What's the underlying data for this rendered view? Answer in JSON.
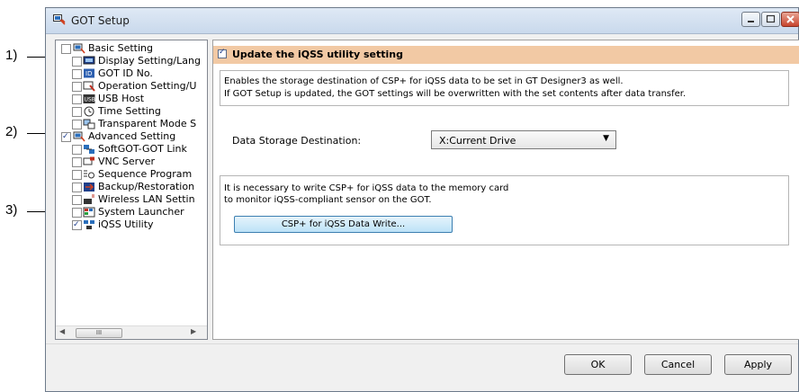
{
  "callouts": [
    "1)",
    "2)",
    "3)"
  ],
  "window": {
    "title": "GOT Setup",
    "controls": [
      "minimize-icon",
      "maximize-icon",
      "close-icon"
    ]
  },
  "tree": {
    "items": [
      {
        "label": "Basic Setting",
        "checked": false,
        "icon": "settings-folder-icon"
      },
      {
        "label": "Display Setting/Lang",
        "checked": false,
        "icon": "display-icon"
      },
      {
        "label": "GOT ID No.",
        "checked": false,
        "icon": "id-icon"
      },
      {
        "label": "Operation Setting/U",
        "checked": false,
        "icon": "operation-icon"
      },
      {
        "label": "USB Host",
        "checked": false,
        "icon": "usb-icon"
      },
      {
        "label": "Time Setting",
        "checked": false,
        "icon": "clock-icon"
      },
      {
        "label": "Transparent Mode S",
        "checked": false,
        "icon": "transparent-mode-icon"
      },
      {
        "label": "Advanced Setting",
        "checked": true,
        "icon": "settings-folder-icon"
      },
      {
        "label": "SoftGOT-GOT Link",
        "checked": false,
        "icon": "link-icon"
      },
      {
        "label": "VNC Server",
        "checked": false,
        "icon": "vnc-icon"
      },
      {
        "label": "Sequence Program",
        "checked": false,
        "icon": "sequence-icon"
      },
      {
        "label": "Backup/Restoration",
        "checked": false,
        "icon": "backup-icon"
      },
      {
        "label": "Wireless LAN Settin",
        "checked": false,
        "icon": "wireless-icon"
      },
      {
        "label": "System Launcher",
        "checked": false,
        "icon": "launcher-icon"
      },
      {
        "label": "iQSS Utility",
        "checked": true,
        "icon": "iqss-icon"
      }
    ],
    "scroll_thumb": "III"
  },
  "main": {
    "header_checkbox_checked": true,
    "header_label": "Update the iQSS utility setting",
    "description": [
      "Enables the storage destination of CSP+ for iQSS data to be set in GT Designer3 as well.",
      "If GOT Setup is updated, the GOT settings will be overwritten with the set contents after data transfer."
    ],
    "storage_label": "Data Storage Destination:",
    "storage_value": "X:Current Drive",
    "write_info": [
      "It is necessary to write CSP+ for iQSS data to the memory card",
      "to monitor iQSS-compliant sensor on the GOT."
    ],
    "write_button": "CSP+ for iQSS Data Write..."
  },
  "buttons": {
    "ok": "OK",
    "cancel": "Cancel",
    "apply": "Apply"
  },
  "colors": {
    "header_bg": "#f2c9a4",
    "accent_button": "#bde2f7"
  }
}
